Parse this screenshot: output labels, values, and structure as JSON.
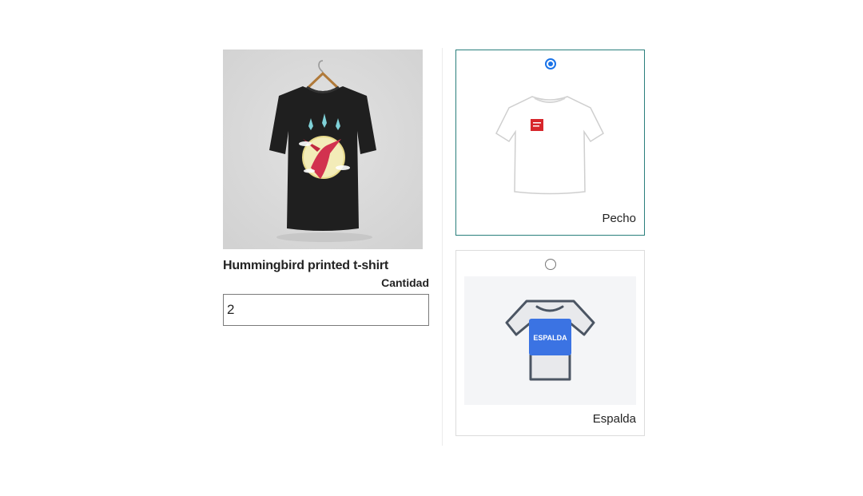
{
  "product": {
    "name": "Hummingbird printed t-shirt",
    "quantity_label": "Cantidad",
    "quantity_value": "2"
  },
  "options": [
    {
      "label": "Pecho",
      "selected": true,
      "badge_text": ""
    },
    {
      "label": "Espalda",
      "selected": false,
      "badge_text": "ESPALDA"
    }
  ],
  "colors": {
    "selected_border": "#2a7f7c",
    "radio_accent": "#1a73e8",
    "espalda_badge": "#3b73e3",
    "chest_patch": "#d7262b"
  }
}
